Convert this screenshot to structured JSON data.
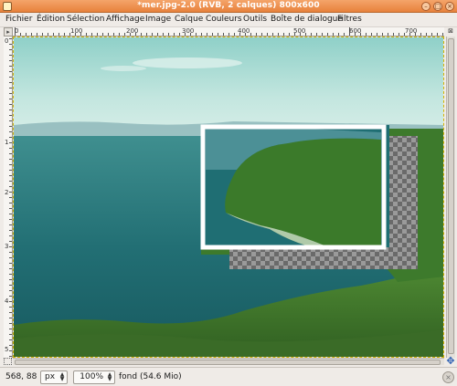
{
  "window": {
    "title": "*mer.jpg-2.0 (RVB, 2 calques) 800x600",
    "minimize_glyph": "–",
    "maximize_glyph": "□",
    "close_glyph": "×"
  },
  "menu": {
    "items": [
      "Fichier",
      "Édition",
      "Sélection",
      "Affichage",
      "Image",
      "Calque",
      "Couleurs",
      "Outils",
      "Boîte de dialogue",
      "Filtres"
    ]
  },
  "rulers": {
    "top_labels": [
      "0",
      "100",
      "200",
      "300",
      "400",
      "500",
      "600",
      "700"
    ],
    "left_labels": [
      "0",
      "1",
      "2",
      "3",
      "4",
      "5"
    ],
    "corner_glyph": "▸",
    "nav_glyph": "⊠"
  },
  "statusbar": {
    "coords": "568, 88",
    "unit": "px",
    "zoom": "100%",
    "layer_info": "fond (54.6 Mio)",
    "cancel_glyph": "×"
  },
  "icons": {
    "navigate": "move-icon",
    "quick_mask": "quick-mask-icon"
  },
  "colors": {
    "titlebar": "#e8823c",
    "selection_frame": "#ffffff",
    "sea": "#1f6e73",
    "sky": "#a9d8d2"
  }
}
